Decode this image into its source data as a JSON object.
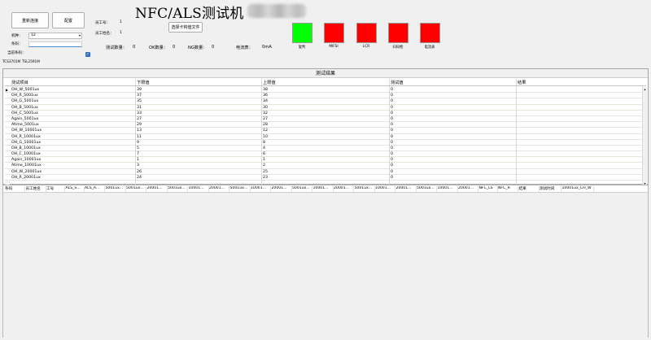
{
  "header": {
    "title": "NFC/ALS测试机",
    "btn_reconnect": "重新连接",
    "btn_config": "配置",
    "operator_id_label": "员工号：",
    "operator_id_value": "1",
    "operator_name_label": "员工姓名：",
    "operator_name_value": "1",
    "btn_select_file": "选择卡钩值文件",
    "machine_label": "机种：",
    "machine_value": "12",
    "barcode_label": "条码：",
    "current_barcode_label": "当前条码：",
    "device1": "TCS3701M",
    "device2": "TSL2591M"
  },
  "stats": {
    "test_count_label": "测试数量：",
    "test_count": "0",
    "ok_label": "OK数量：",
    "ok_count": "0",
    "ng_label": "NG数量：",
    "ng_count": "0",
    "current_label": "电流表：",
    "current_value": "0mA"
  },
  "indicators": [
    {
      "label": "复判",
      "color": "#00ff00"
    },
    {
      "label": "MIFSI",
      "color": "#ff0000"
    },
    {
      "label": "LCR",
      "color": "#ff0000"
    },
    {
      "label": "扫码枪",
      "color": "#ff0000"
    },
    {
      "label": "电流表",
      "color": "#ff0000"
    }
  ],
  "results": {
    "group_title": "测试结果",
    "columns": [
      "测试项目",
      "下限值",
      "上限值",
      "测试值",
      "结果"
    ],
    "rows": [
      [
        "OH_W_5001ux",
        "39",
        "38",
        "0",
        ""
      ],
      [
        "OH_R_5001ux",
        "37",
        "36",
        "0",
        ""
      ],
      [
        "OH_G_5001ux",
        "35",
        "34",
        "0",
        ""
      ],
      [
        "OH_B_5001ux",
        "31",
        "30",
        "0",
        ""
      ],
      [
        "OH_C_5001ux",
        "33",
        "32",
        "0",
        ""
      ],
      [
        "Again_5001ux",
        "27",
        "27",
        "0",
        ""
      ],
      [
        "Atime_5001ux",
        "29",
        "28",
        "0",
        ""
      ],
      [
        "OH_W_10001ux",
        "13",
        "12",
        "0",
        ""
      ],
      [
        "OH_R_10001ux",
        "11",
        "10",
        "0",
        ""
      ],
      [
        "OH_G_10001ux",
        "9",
        "8",
        "0",
        ""
      ],
      [
        "OH_B_10001ux",
        "5",
        "4",
        "0",
        ""
      ],
      [
        "OH_C_10001ux",
        "7",
        "6",
        "0",
        ""
      ],
      [
        "Again_10001ux",
        "1",
        "1",
        "0",
        ""
      ],
      [
        "Atime_10001ux",
        "3",
        "2",
        "0",
        ""
      ],
      [
        "OH_W_20001ux",
        "26",
        "25",
        "0",
        ""
      ],
      [
        "OH_R_20001ux",
        "24",
        "23",
        "0",
        ""
      ]
    ]
  },
  "log": {
    "columns": [
      "条码",
      "员工姓名",
      "工号",
      "ALS_S...",
      "ALS_A...",
      "5001ux...",
      "5001ux...",
      "20001...",
      "5001ux...",
      "10001...",
      "20001...",
      "5001ux...",
      "10001...",
      "20001...",
      "5001ux...",
      "10001...",
      "20001...",
      "5001ux...",
      "10001...",
      "20001...",
      "5001ux...",
      "10001...",
      "20001...",
      "NFC_LS",
      "NFC_R",
      "结果",
      "测试时间",
      "10001ux_CH_W"
    ]
  }
}
